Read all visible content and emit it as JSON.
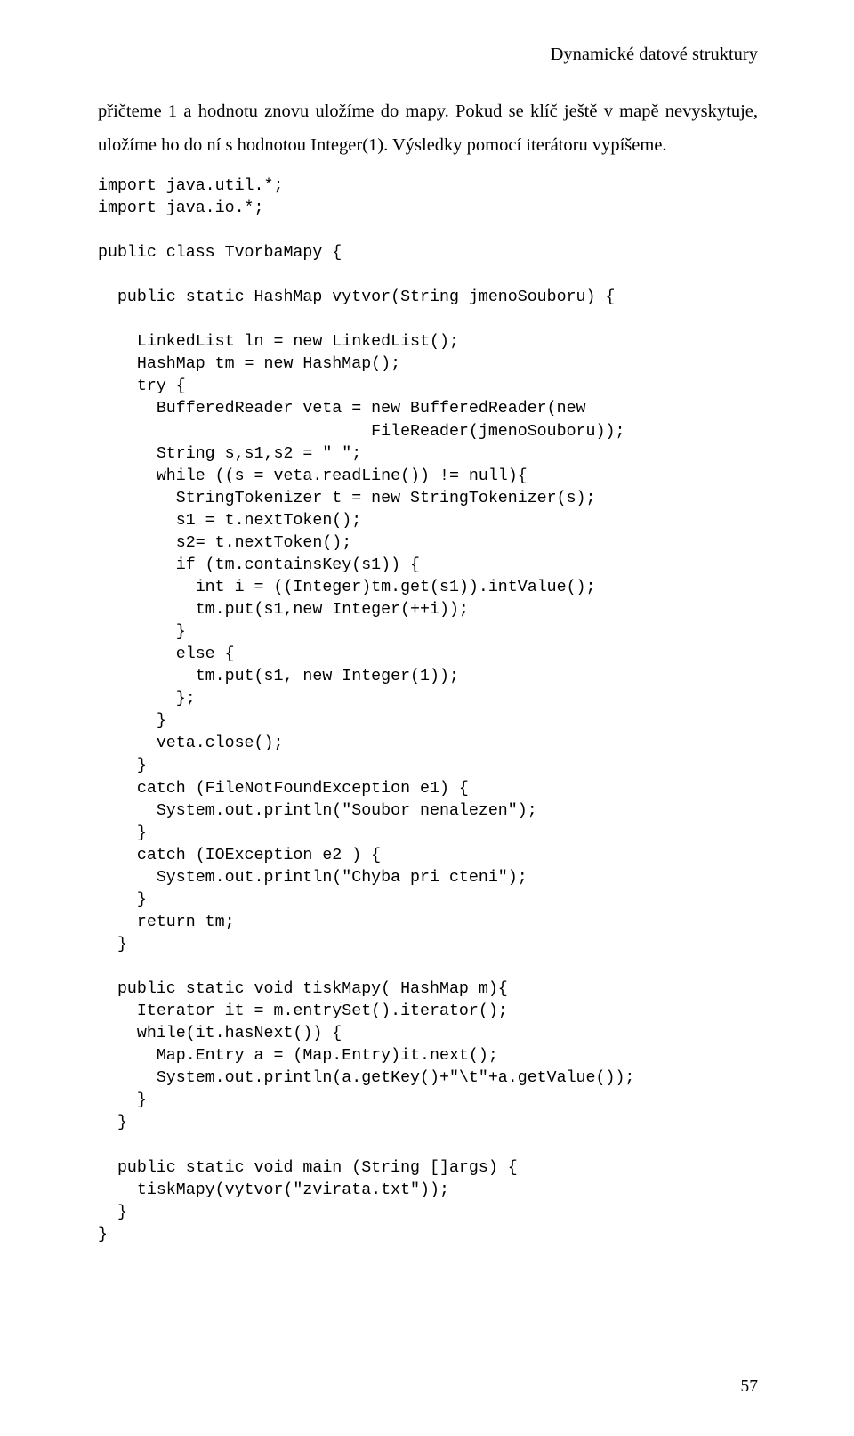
{
  "header": {
    "running_title": "Dynamické datové struktury"
  },
  "body": {
    "paragraph1": "přičteme 1 a hodnotu znovu uložíme do mapy. Pokud se klíč ještě v mapě nevyskytuje, uložíme ho do ní s hodnotou Integer(1). Výsledky pomocí iterátoru vypíšeme."
  },
  "code": {
    "block": "import java.util.*;\nimport java.io.*;\n\npublic class TvorbaMapy {\n\n  public static HashMap vytvor(String jmenoSouboru) {\n\n    LinkedList ln = new LinkedList();\n    HashMap tm = new HashMap();\n    try {\n      BufferedReader veta = new BufferedReader(new\n                            FileReader(jmenoSouboru));\n      String s,s1,s2 = \" \";\n      while ((s = veta.readLine()) != null){\n        StringTokenizer t = new StringTokenizer(s);\n        s1 = t.nextToken();\n        s2= t.nextToken();\n        if (tm.containsKey(s1)) {\n          int i = ((Integer)tm.get(s1)).intValue();\n          tm.put(s1,new Integer(++i));\n        }\n        else {\n          tm.put(s1, new Integer(1));\n        };\n      }\n      veta.close();\n    }\n    catch (FileNotFoundException e1) {\n      System.out.println(\"Soubor nenalezen\");\n    }\n    catch (IOException e2 ) {\n      System.out.println(\"Chyba pri cteni\");\n    }\n    return tm;\n  }\n\n  public static void tiskMapy( HashMap m){\n    Iterator it = m.entrySet().iterator();\n    while(it.hasNext()) {\n      Map.Entry a = (Map.Entry)it.next();\n      System.out.println(a.getKey()+\"\\t\"+a.getValue());\n    }\n  }\n\n  public static void main (String []args) {\n    tiskMapy(vytvor(\"zvirata.txt\"));\n  }\n}"
  },
  "footer": {
    "page_number": "57"
  }
}
